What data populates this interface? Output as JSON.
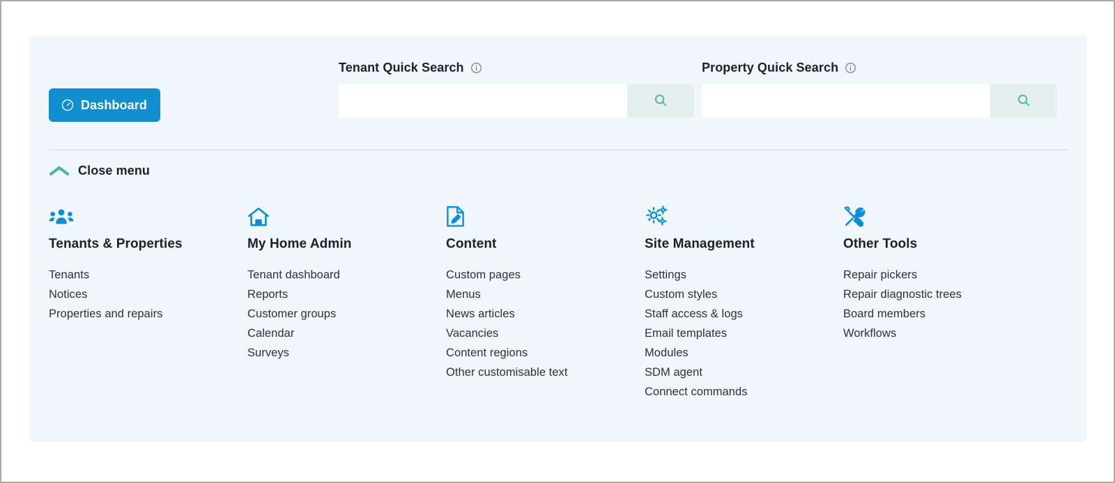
{
  "accent": {
    "brand_blue": "#108ed0",
    "icon_blue": "#0b8ed6",
    "teal": "#4eb3a5",
    "panel_bg": "#eff7fb",
    "search_btn_bg": "#e4f0ee",
    "divider": "#b6e2f5",
    "text": "#1d2125"
  },
  "dashboard": {
    "label": "Dashboard",
    "icon": "gauge-icon"
  },
  "quick_search": [
    {
      "id": "tenant",
      "label": "Tenant Quick Search",
      "info_icon": "info-circle-icon",
      "value": "",
      "placeholder": "",
      "button_icon": "search-icon"
    },
    {
      "id": "property",
      "label": "Property Quick Search",
      "info_icon": "info-circle-icon",
      "value": "",
      "placeholder": "",
      "button_icon": "search-icon"
    }
  ],
  "close_menu": {
    "label": "Close menu",
    "icon": "chevron-up-icon"
  },
  "columns": [
    {
      "icon": "people-group-icon",
      "title": "Tenants & Properties",
      "links": [
        "Tenants",
        "Notices",
        "Properties and repairs"
      ]
    },
    {
      "icon": "home-icon",
      "title": "My Home Admin",
      "links": [
        "Tenant dashboard",
        "Reports",
        "Customer groups",
        "Calendar",
        "Surveys"
      ]
    },
    {
      "icon": "document-edit-icon",
      "title": "Content",
      "links": [
        "Custom pages",
        "Menus",
        "News articles",
        "Vacancies",
        "Content regions",
        "Other customisable text"
      ]
    },
    {
      "icon": "gears-icon",
      "title": "Site Management",
      "links": [
        "Settings",
        "Custom styles",
        "Staff access & logs",
        "Email templates",
        "Modules",
        "SDM agent",
        "Connect commands"
      ]
    },
    {
      "icon": "tools-icon",
      "title": "Other Tools",
      "links": [
        "Repair pickers",
        "Repair diagnostic trees",
        "Board members",
        "Workflows"
      ]
    }
  ]
}
